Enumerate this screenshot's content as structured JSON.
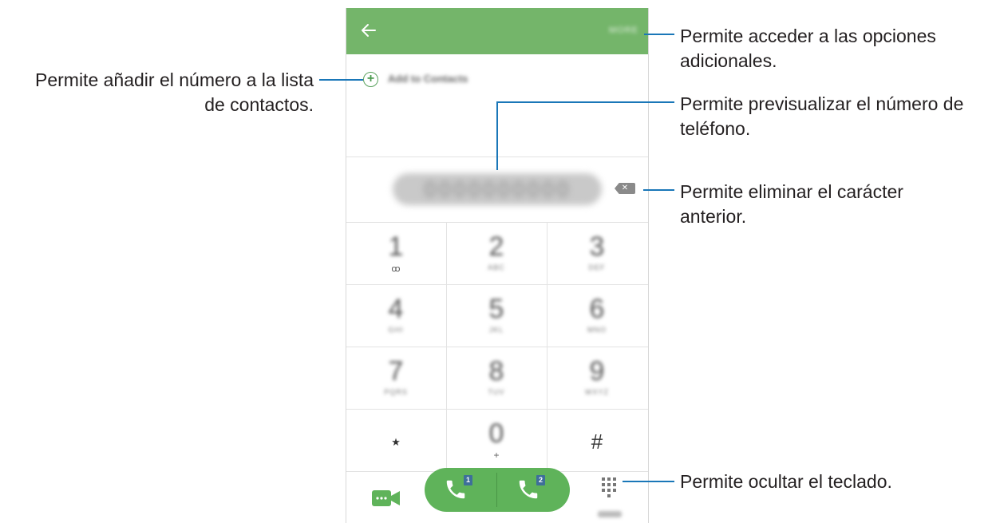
{
  "phone": {
    "appbar": {
      "back_icon": "arrow-left-icon",
      "more_label": "MORE",
      "color": "#74b56a"
    },
    "add_to_contacts": {
      "icon": "plus-circle-icon",
      "label": "Add to Contacts"
    },
    "number_display": {
      "value": "0000000000"
    },
    "delete_icon": "backspace-icon",
    "keypad": [
      {
        "digit": "1",
        "letters": "",
        "sub": "ꝏ"
      },
      {
        "digit": "2",
        "letters": "ABC"
      },
      {
        "digit": "3",
        "letters": "DEF"
      },
      {
        "digit": "4",
        "letters": "GHI"
      },
      {
        "digit": "5",
        "letters": "JKL"
      },
      {
        "digit": "6",
        "letters": "MNO"
      },
      {
        "digit": "7",
        "letters": "PQRS"
      },
      {
        "digit": "8",
        "letters": "TUV"
      },
      {
        "digit": "9",
        "letters": "WXYZ"
      },
      {
        "digit": "⋆",
        "letters": ""
      },
      {
        "digit": "0",
        "letters": "",
        "sub": "+"
      },
      {
        "digit": "#",
        "letters": ""
      }
    ],
    "bottom_bar": {
      "video_icon": "video-call-icon",
      "call_sim1": {
        "icon": "phone-icon",
        "badge": "1"
      },
      "call_sim2": {
        "icon": "phone-icon",
        "badge": "2"
      },
      "dialpad_icon": "dialpad-icon",
      "dialpad_label": "Hide",
      "call_color": "#5fb35a"
    }
  },
  "callouts": {
    "more_options": "Permite acceder a las opciones adicionales.",
    "more_options_l1": "Permite acceder a las opciones",
    "more_options_l2": "adicionales.",
    "add_contact_l1": "Permite añadir el número a la lista",
    "add_contact_l2": "de contactos.",
    "preview_l1": "Permite previsualizar el número de",
    "preview_l2": "teléfono.",
    "delete_l1": "Permite eliminar el carácter",
    "delete_l2": "anterior.",
    "hide_keypad": "Permite ocultar el teclado.",
    "line_color": "#1a77b8"
  }
}
